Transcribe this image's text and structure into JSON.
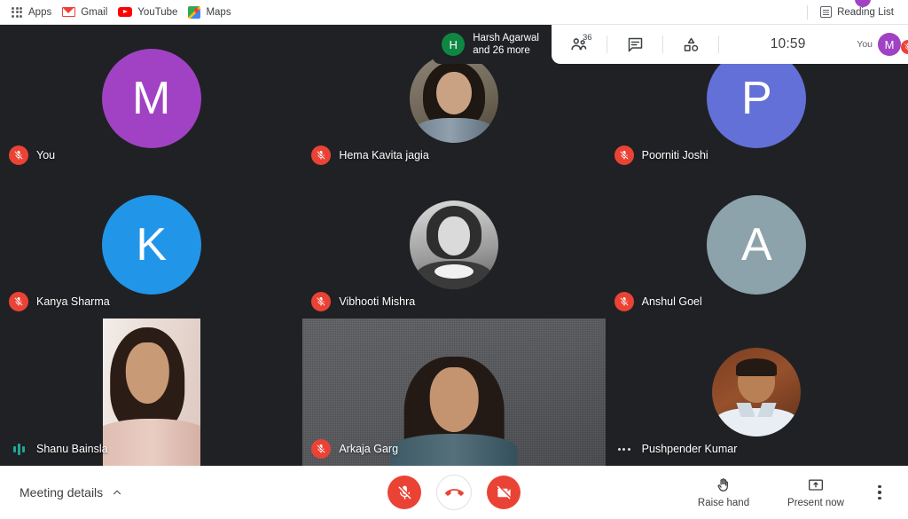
{
  "browser": {
    "bookmarks": [
      {
        "label": "Apps",
        "icon": "apps-grid-icon"
      },
      {
        "label": "Gmail",
        "icon": "gmail-icon"
      },
      {
        "label": "YouTube",
        "icon": "youtube-icon"
      },
      {
        "label": "Maps",
        "icon": "maps-icon"
      }
    ],
    "reading_list": {
      "label": "Reading List",
      "icon": "reading-list-icon"
    }
  },
  "topbar": {
    "active_speaker": {
      "avatar_initial": "H",
      "avatar_color": "#0f8743",
      "line1": "Harsh Agarwal",
      "line2": "and 26 more"
    },
    "people_icon": "people-icon",
    "people_count": "36",
    "chat_icon": "chat-icon",
    "activities_icon": "activities-icon",
    "time": "10:59",
    "you_label": "You",
    "you_avatar_initial": "M",
    "you_avatar_color": "#a142c4",
    "you_mic_icon": "mic-off-icon"
  },
  "participants": [
    {
      "name": "You",
      "kind": "initial",
      "initial": "M",
      "color": "#a142c4",
      "status_icon": "mic-off-icon"
    },
    {
      "name": "Hema Kavita jagia",
      "kind": "photo-hema",
      "status_icon": "mic-off-icon"
    },
    {
      "name": "Poorniti Joshi",
      "kind": "initial",
      "initial": "P",
      "color": "#6370d8",
      "status_icon": "mic-off-icon"
    },
    {
      "name": "Kanya Sharma",
      "kind": "initial",
      "initial": "K",
      "color": "#2196e8",
      "status_icon": "mic-off-icon"
    },
    {
      "name": "Vibhooti Mishra",
      "kind": "photo-vib",
      "status_icon": "mic-off-icon"
    },
    {
      "name": "Anshul Goel",
      "kind": "initial",
      "initial": "A",
      "color": "#8da3ab",
      "status_icon": "mic-off-icon"
    },
    {
      "name": "Shanu Bainsla",
      "kind": "video-shanu",
      "status_icon": "speaking-waveform-icon"
    },
    {
      "name": "Arkaja Garg",
      "kind": "video-arkaja",
      "status_icon": "mic-off-icon"
    },
    {
      "name": "Pushpender Kumar",
      "kind": "photo-push",
      "status_icon": "more-options-icon"
    }
  ],
  "bottombar": {
    "meeting_details_label": "Meeting details",
    "meeting_details_icon": "chevron-up-icon",
    "mic_button": {
      "icon": "mic-off-icon",
      "state": "muted"
    },
    "hangup_button": {
      "icon": "end-call-icon"
    },
    "camera_button": {
      "icon": "camera-off-icon",
      "state": "off"
    },
    "raise_hand": {
      "label": "Raise hand",
      "icon": "raise-hand-icon"
    },
    "present_now": {
      "label": "Present now",
      "icon": "present-screen-icon"
    },
    "more_options": {
      "icon": "more-vertical-icon"
    }
  },
  "colors": {
    "stage_bg": "#202124",
    "danger": "#ea4335",
    "speaking": "#1ea896",
    "bar_bg": "#ffffff"
  }
}
